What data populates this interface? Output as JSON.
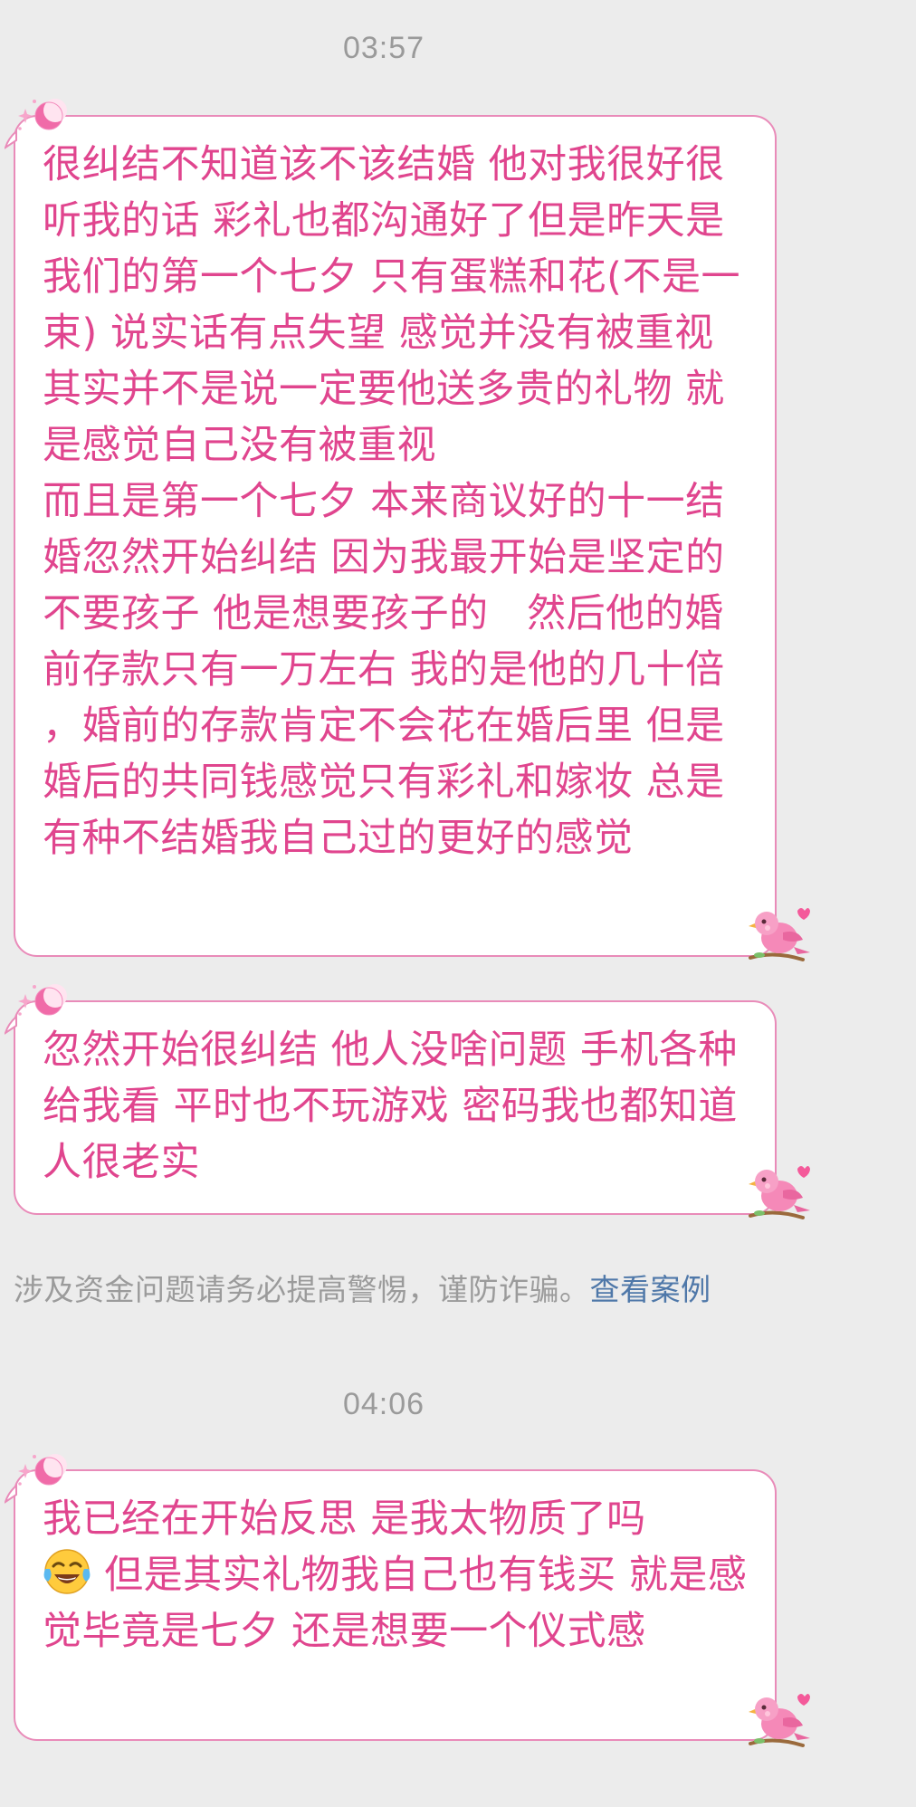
{
  "colors": {
    "background": "#ececec",
    "bubble_border": "#e98bb9",
    "message_text": "#e0458e",
    "link": "#4f78a9",
    "muted_text": "#9b9b9b"
  },
  "timestamps": [
    "03:57",
    "04:06"
  ],
  "messages": [
    {
      "text": "很纠结不知道该不该结婚 他对我很好很听我的话 彩礼也都沟通好了但是昨天是我们的第一个七夕 只有蛋糕和花(不是一束) 说实话有点失望 感觉并没有被重视 其实并不是说一定要他送多贵的礼物 就是感觉自己没有被重视\n而且是第一个七夕 本来商议好的十一结婚忽然开始纠结 因为我最开始是坚定的不要孩子 他是想要孩子的   然后他的婚前存款只有一万左右 我的是他的几十倍 ，婚前的存款肯定不会花在婚后里 但是婚后的共同钱感觉只有彩礼和嫁妆 总是有种不结婚我自己过的更好的感觉"
    },
    {
      "text": "忽然开始很纠结 他人没啥问题 手机各种给我看 平时也不玩游戏 密码我也都知道 人很老实"
    },
    {
      "text_before_emoji": "我已经在开始反思 是我太物质了吗",
      "emoji": "tears-of-joy-emoji",
      "text_after_emoji": " 但是其实礼物我自己也有钱买 就是感觉毕竟是七夕 还是想要一个仪式感"
    }
  ],
  "notice": {
    "text": "涉及资金问题请务必提高警惕，谨防诈骗。",
    "link_label": "查看案例"
  },
  "icons": {
    "bubble_top_decoration": "moon-sparkle-icon",
    "bubble_bottom_decoration": "pink-bird-icon"
  }
}
